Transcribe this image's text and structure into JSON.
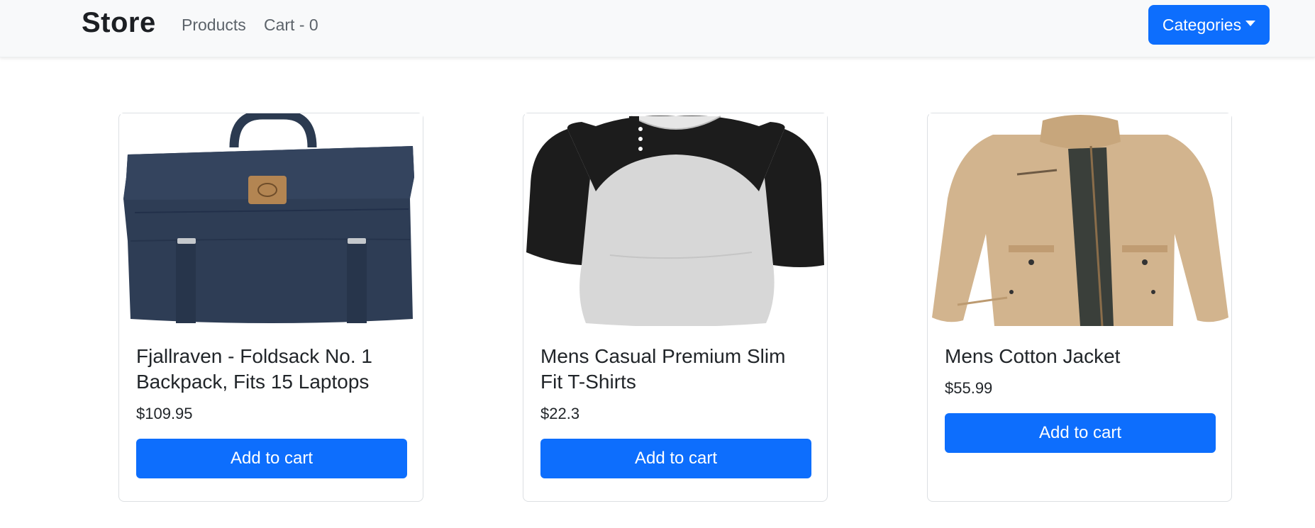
{
  "navbar": {
    "brand": "Store",
    "links": {
      "products": "Products",
      "cart": "Cart - 0"
    },
    "categories_label": "Categories"
  },
  "colors": {
    "primary": "#0d6efd",
    "navbar_bg": "#f8f9fa",
    "card_border": "#dcdfe3"
  },
  "products": [
    {
      "title": "Fjallraven - Foldsack No. 1 Backpack, Fits 15 Laptops",
      "price": "$109.95",
      "button": "Add to cart",
      "image_icon": "backpack-image"
    },
    {
      "title": "Mens Casual Premium Slim Fit T-Shirts",
      "price": "$22.3",
      "button": "Add to cart",
      "image_icon": "tshirt-image"
    },
    {
      "title": "Mens Cotton Jacket",
      "price": "$55.99",
      "button": "Add to cart",
      "image_icon": "jacket-image"
    }
  ]
}
